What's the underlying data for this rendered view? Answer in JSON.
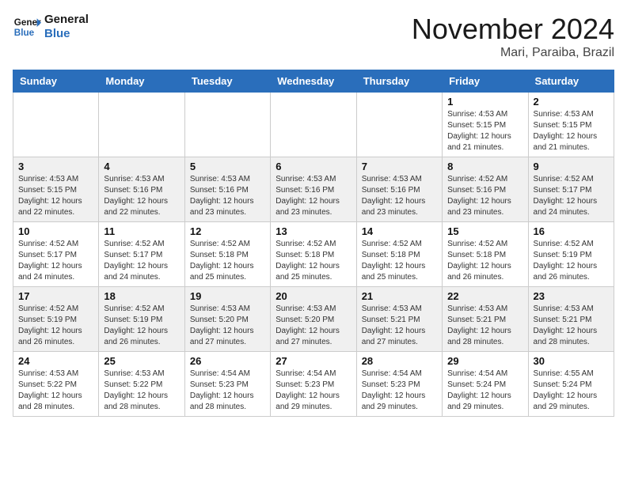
{
  "header": {
    "logo_line1": "General",
    "logo_line2": "Blue",
    "month": "November 2024",
    "location": "Mari, Paraiba, Brazil"
  },
  "weekdays": [
    "Sunday",
    "Monday",
    "Tuesday",
    "Wednesday",
    "Thursday",
    "Friday",
    "Saturday"
  ],
  "weeks": [
    [
      {
        "day": "",
        "info": ""
      },
      {
        "day": "",
        "info": ""
      },
      {
        "day": "",
        "info": ""
      },
      {
        "day": "",
        "info": ""
      },
      {
        "day": "",
        "info": ""
      },
      {
        "day": "1",
        "info": "Sunrise: 4:53 AM\nSunset: 5:15 PM\nDaylight: 12 hours\nand 21 minutes."
      },
      {
        "day": "2",
        "info": "Sunrise: 4:53 AM\nSunset: 5:15 PM\nDaylight: 12 hours\nand 21 minutes."
      }
    ],
    [
      {
        "day": "3",
        "info": "Sunrise: 4:53 AM\nSunset: 5:15 PM\nDaylight: 12 hours\nand 22 minutes."
      },
      {
        "day": "4",
        "info": "Sunrise: 4:53 AM\nSunset: 5:16 PM\nDaylight: 12 hours\nand 22 minutes."
      },
      {
        "day": "5",
        "info": "Sunrise: 4:53 AM\nSunset: 5:16 PM\nDaylight: 12 hours\nand 23 minutes."
      },
      {
        "day": "6",
        "info": "Sunrise: 4:53 AM\nSunset: 5:16 PM\nDaylight: 12 hours\nand 23 minutes."
      },
      {
        "day": "7",
        "info": "Sunrise: 4:53 AM\nSunset: 5:16 PM\nDaylight: 12 hours\nand 23 minutes."
      },
      {
        "day": "8",
        "info": "Sunrise: 4:52 AM\nSunset: 5:16 PM\nDaylight: 12 hours\nand 23 minutes."
      },
      {
        "day": "9",
        "info": "Sunrise: 4:52 AM\nSunset: 5:17 PM\nDaylight: 12 hours\nand 24 minutes."
      }
    ],
    [
      {
        "day": "10",
        "info": "Sunrise: 4:52 AM\nSunset: 5:17 PM\nDaylight: 12 hours\nand 24 minutes."
      },
      {
        "day": "11",
        "info": "Sunrise: 4:52 AM\nSunset: 5:17 PM\nDaylight: 12 hours\nand 24 minutes."
      },
      {
        "day": "12",
        "info": "Sunrise: 4:52 AM\nSunset: 5:18 PM\nDaylight: 12 hours\nand 25 minutes."
      },
      {
        "day": "13",
        "info": "Sunrise: 4:52 AM\nSunset: 5:18 PM\nDaylight: 12 hours\nand 25 minutes."
      },
      {
        "day": "14",
        "info": "Sunrise: 4:52 AM\nSunset: 5:18 PM\nDaylight: 12 hours\nand 25 minutes."
      },
      {
        "day": "15",
        "info": "Sunrise: 4:52 AM\nSunset: 5:18 PM\nDaylight: 12 hours\nand 26 minutes."
      },
      {
        "day": "16",
        "info": "Sunrise: 4:52 AM\nSunset: 5:19 PM\nDaylight: 12 hours\nand 26 minutes."
      }
    ],
    [
      {
        "day": "17",
        "info": "Sunrise: 4:52 AM\nSunset: 5:19 PM\nDaylight: 12 hours\nand 26 minutes."
      },
      {
        "day": "18",
        "info": "Sunrise: 4:52 AM\nSunset: 5:19 PM\nDaylight: 12 hours\nand 26 minutes."
      },
      {
        "day": "19",
        "info": "Sunrise: 4:53 AM\nSunset: 5:20 PM\nDaylight: 12 hours\nand 27 minutes."
      },
      {
        "day": "20",
        "info": "Sunrise: 4:53 AM\nSunset: 5:20 PM\nDaylight: 12 hours\nand 27 minutes."
      },
      {
        "day": "21",
        "info": "Sunrise: 4:53 AM\nSunset: 5:21 PM\nDaylight: 12 hours\nand 27 minutes."
      },
      {
        "day": "22",
        "info": "Sunrise: 4:53 AM\nSunset: 5:21 PM\nDaylight: 12 hours\nand 28 minutes."
      },
      {
        "day": "23",
        "info": "Sunrise: 4:53 AM\nSunset: 5:21 PM\nDaylight: 12 hours\nand 28 minutes."
      }
    ],
    [
      {
        "day": "24",
        "info": "Sunrise: 4:53 AM\nSunset: 5:22 PM\nDaylight: 12 hours\nand 28 minutes."
      },
      {
        "day": "25",
        "info": "Sunrise: 4:53 AM\nSunset: 5:22 PM\nDaylight: 12 hours\nand 28 minutes."
      },
      {
        "day": "26",
        "info": "Sunrise: 4:54 AM\nSunset: 5:23 PM\nDaylight: 12 hours\nand 28 minutes."
      },
      {
        "day": "27",
        "info": "Sunrise: 4:54 AM\nSunset: 5:23 PM\nDaylight: 12 hours\nand 29 minutes."
      },
      {
        "day": "28",
        "info": "Sunrise: 4:54 AM\nSunset: 5:23 PM\nDaylight: 12 hours\nand 29 minutes."
      },
      {
        "day": "29",
        "info": "Sunrise: 4:54 AM\nSunset: 5:24 PM\nDaylight: 12 hours\nand 29 minutes."
      },
      {
        "day": "30",
        "info": "Sunrise: 4:55 AM\nSunset: 5:24 PM\nDaylight: 12 hours\nand 29 minutes."
      }
    ]
  ]
}
